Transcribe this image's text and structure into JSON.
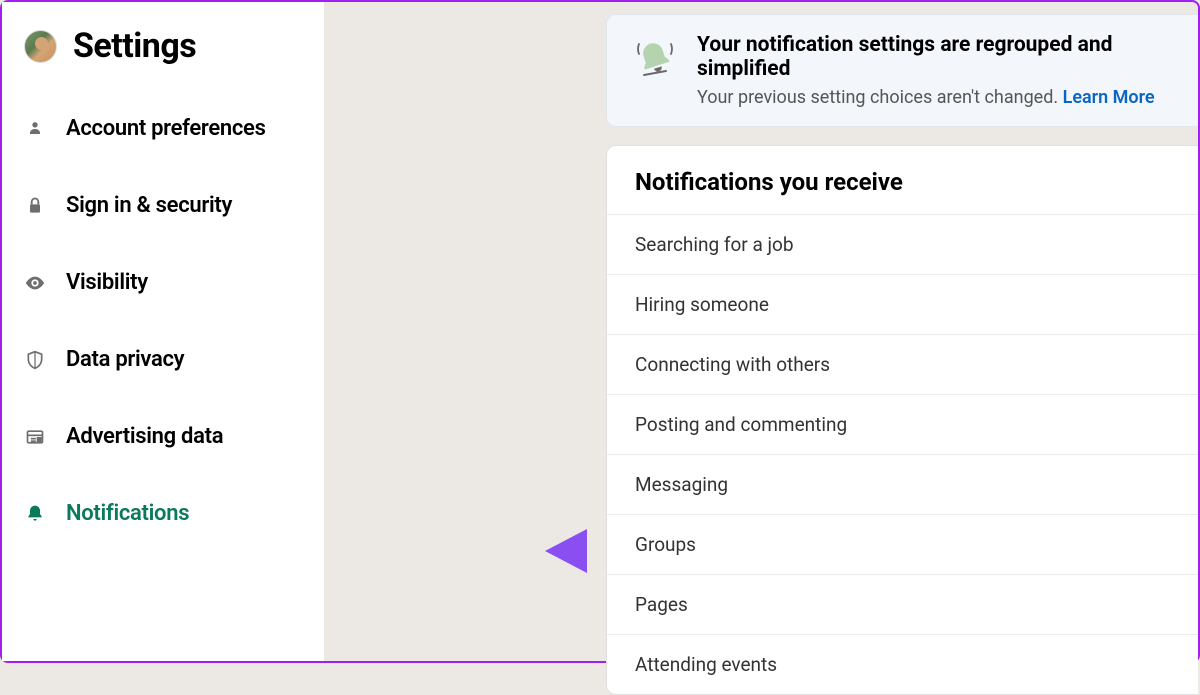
{
  "page": {
    "title": "Settings"
  },
  "sidebar": {
    "items": [
      {
        "label": "Account preferences",
        "icon": "person-icon",
        "active": false
      },
      {
        "label": "Sign in & security",
        "icon": "lock-icon",
        "active": false
      },
      {
        "label": "Visibility",
        "icon": "eye-icon",
        "active": false
      },
      {
        "label": "Data privacy",
        "icon": "shield-icon",
        "active": false
      },
      {
        "label": "Advertising data",
        "icon": "newspaper-icon",
        "active": false
      },
      {
        "label": "Notifications",
        "icon": "bell-icon",
        "active": true
      }
    ]
  },
  "banner": {
    "title": "Your notification settings are regrouped and simplified",
    "subtitle": "Your previous setting choices aren't changed. ",
    "link": "Learn More"
  },
  "panel": {
    "title": "Notifications you receive",
    "items": [
      {
        "label": "Searching for a job"
      },
      {
        "label": "Hiring someone"
      },
      {
        "label": "Connecting with others"
      },
      {
        "label": "Posting and commenting"
      },
      {
        "label": "Messaging"
      },
      {
        "label": "Groups"
      },
      {
        "label": "Pages"
      },
      {
        "label": "Attending events"
      }
    ]
  }
}
